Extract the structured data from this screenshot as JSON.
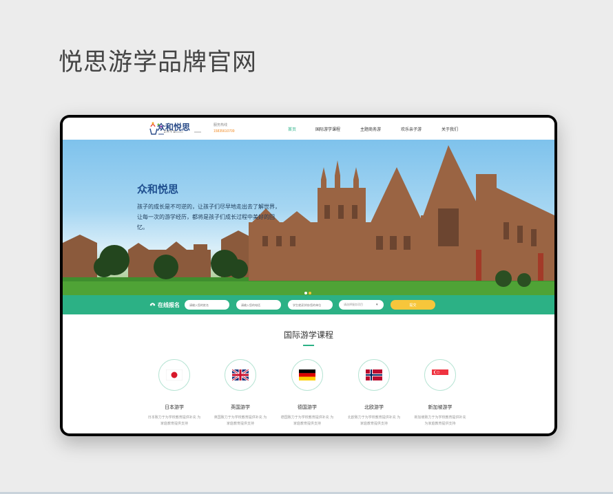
{
  "page": {
    "heading": "悦思游学品牌官网"
  },
  "header": {
    "logo_text": "众和悦思",
    "logo_sub": "ZHYS",
    "hotline_label": "服务热线",
    "hotline_number": "15835610709",
    "nav": [
      "首页",
      "国际游学课程",
      "主题商务游",
      "欢乐亲子游",
      "关于我们"
    ],
    "nav_active_index": 0
  },
  "hero": {
    "title": "众和悦思",
    "text": "孩子的成长是不可逆的，让孩子们尽早地走出去了解世界，让每一次的游学经历，都将是孩子们成长过程中美好的回忆。",
    "slides": 2,
    "active_slide": 1
  },
  "signup": {
    "label": "在线报名",
    "name_placeholder": "请输入您的姓名",
    "phone_placeholder": "请输入您的电话",
    "school_placeholder": "学生就读学校/您的单位",
    "select_placeholder": "请选择服务项目",
    "submit": "提交"
  },
  "courses": {
    "title": "国际游学课程",
    "items": [
      {
        "name": "日本游学",
        "desc": "日本致力于为学校教育提供补充 为家庭教育提供支持",
        "flag": "japan-flag"
      },
      {
        "name": "英国游学",
        "desc": "英国致力于为学校教育提供补充 为家庭教育提供支持",
        "flag": "uk-flag"
      },
      {
        "name": "德国游学",
        "desc": "德国致力于为学校教育提供补充 为家庭教育提供支持",
        "flag": "germany-flag"
      },
      {
        "name": "北欧游学",
        "desc": "北欧致力于为学校教育提供补充 为家庭教育提供支持",
        "flag": "norway-flag"
      },
      {
        "name": "新加坡游学",
        "desc": "新加坡致力于为学校教育提供补充 为家庭教育提供支持",
        "flag": "singapore-flag"
      }
    ]
  },
  "colors": {
    "accent": "#2cb185",
    "submit": "#f7c63b",
    "brand": "#2d4e8a"
  }
}
